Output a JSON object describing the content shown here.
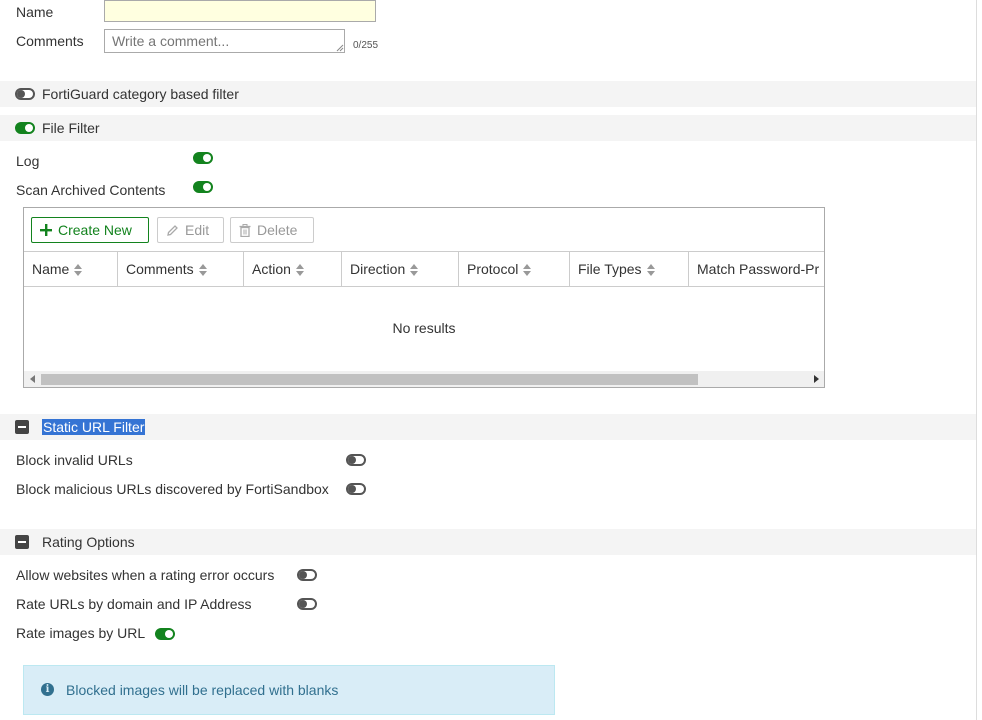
{
  "form": {
    "name_label": "Name",
    "name_value": "",
    "comments_label": "Comments",
    "comments_placeholder": "Write a comment...",
    "comments_counter": "0/255"
  },
  "sections": {
    "fortiguard": {
      "title": "FortiGuard category based filter",
      "enabled": false
    },
    "file_filter": {
      "title": "File Filter",
      "enabled": true
    },
    "static_url": {
      "title": "Static URL Filter"
    },
    "rating": {
      "title": "Rating Options"
    }
  },
  "file_filter": {
    "log_label": "Log",
    "log_enabled": true,
    "scan_label": "Scan Archived Contents",
    "scan_enabled": true
  },
  "toolbar": {
    "create_label": "Create New",
    "edit_label": "Edit",
    "delete_label": "Delete"
  },
  "table": {
    "columns": [
      "Name",
      "Comments",
      "Action",
      "Direction",
      "Protocol",
      "File Types",
      "Match Password-Pr"
    ],
    "empty_text": "No results"
  },
  "static_url": {
    "block_invalid_label": "Block invalid URLs",
    "block_invalid_enabled": false,
    "block_malicious_label": "Block malicious URLs discovered by FortiSandbox",
    "block_malicious_enabled": false
  },
  "rating": {
    "allow_error_label": "Allow websites when a rating error occurs",
    "allow_error_enabled": false,
    "rate_domain_label": "Rate URLs by domain and IP Address",
    "rate_domain_enabled": false,
    "rate_images_label": "Rate images by URL",
    "rate_images_enabled": true
  },
  "info": {
    "text": "Blocked images will be replaced with blanks"
  },
  "colors": {
    "accent_green": "#13831e",
    "info_bg": "#d9edf7",
    "info_text": "#31708f",
    "selection_blue": "#3574d4"
  }
}
